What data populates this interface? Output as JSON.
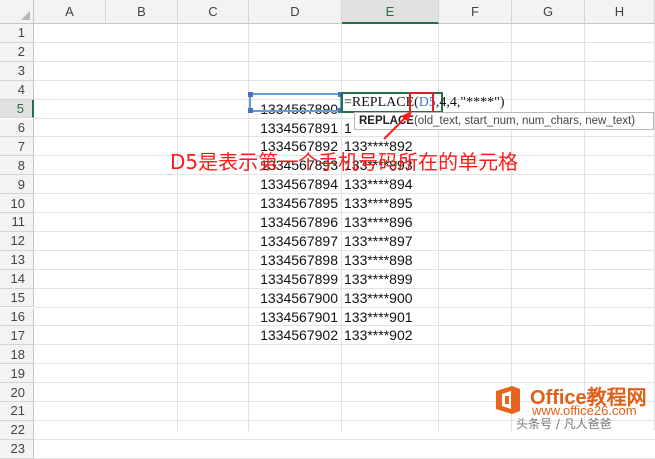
{
  "sheet": {
    "columns": [
      "A",
      "B",
      "C",
      "D",
      "E",
      "F",
      "G",
      "H"
    ],
    "selected_column": "E",
    "rows": [
      "1",
      "2",
      "3",
      "4",
      "5",
      "6",
      "7",
      "8",
      "9",
      "10",
      "11",
      "12",
      "13",
      "14",
      "15",
      "16",
      "17",
      "18",
      "19",
      "20",
      "21",
      "22",
      "23"
    ],
    "selected_row": "5",
    "d_values": [
      "1334567890",
      "1334567891",
      "1334567892",
      "1334567893",
      "1334567894",
      "1334567895",
      "1334567896",
      "1334567897",
      "1334567898",
      "1334567899",
      "1334567900",
      "1334567901",
      "1334567902"
    ],
    "e_values": [
      "",
      "1",
      "133****892",
      "133****893",
      "133****894",
      "133****895",
      "133****896",
      "133****897",
      "133****898",
      "133****899",
      "133****900",
      "133****901",
      "133****902"
    ]
  },
  "formula": {
    "prefix": "=REPLACE(",
    "ref": "D5",
    "suffix": ",4,4,\"****\")"
  },
  "tooltip": {
    "fn_name": "REPLACE",
    "args": "(old_text, start_num, num_chars, new_text)"
  },
  "annotation": {
    "text": "D5是表示第一个手机号码所在的单元格",
    "color": "#ff1a1a"
  },
  "watermark": {
    "title": "Office教程网",
    "url": "www.office26.com",
    "sub": "头条号 / 凡人爸爸"
  },
  "colors": {
    "header_bg": "#f3f3f3",
    "selection_green": "#217346",
    "ref_blue": "#4472c4",
    "annotation_red": "#ff1a1a"
  }
}
